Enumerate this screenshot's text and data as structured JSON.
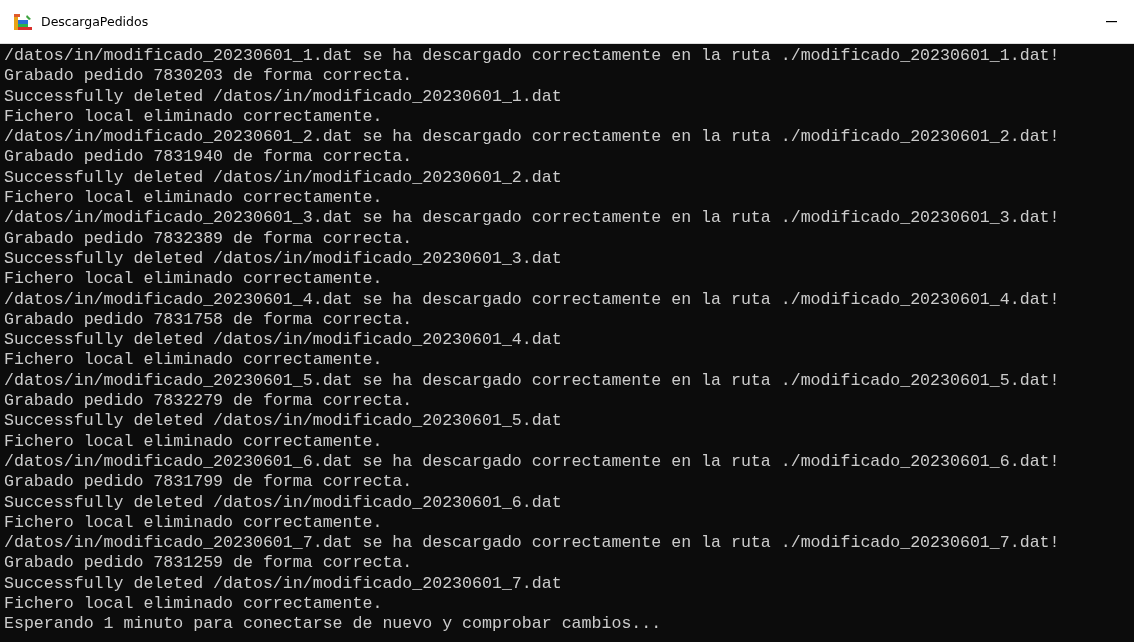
{
  "window": {
    "title": "DescargaPedidos"
  },
  "console": {
    "lines": [
      "/datos/in/modificado_20230601_1.dat se ha descargado correctamente en la ruta ./modificado_20230601_1.dat!",
      "Grabado pedido 7830203 de forma correcta.",
      "Successfully deleted /datos/in/modificado_20230601_1.dat",
      "Fichero local eliminado correctamente.",
      "/datos/in/modificado_20230601_2.dat se ha descargado correctamente en la ruta ./modificado_20230601_2.dat!",
      "Grabado pedido 7831940 de forma correcta.",
      "Successfully deleted /datos/in/modificado_20230601_2.dat",
      "Fichero local eliminado correctamente.",
      "/datos/in/modificado_20230601_3.dat se ha descargado correctamente en la ruta ./modificado_20230601_3.dat!",
      "Grabado pedido 7832389 de forma correcta.",
      "Successfully deleted /datos/in/modificado_20230601_3.dat",
      "Fichero local eliminado correctamente.",
      "/datos/in/modificado_20230601_4.dat se ha descargado correctamente en la ruta ./modificado_20230601_4.dat!",
      "Grabado pedido 7831758 de forma correcta.",
      "Successfully deleted /datos/in/modificado_20230601_4.dat",
      "Fichero local eliminado correctamente.",
      "/datos/in/modificado_20230601_5.dat se ha descargado correctamente en la ruta ./modificado_20230601_5.dat!",
      "Grabado pedido 7832279 de forma correcta.",
      "Successfully deleted /datos/in/modificado_20230601_5.dat",
      "Fichero local eliminado correctamente.",
      "/datos/in/modificado_20230601_6.dat se ha descargado correctamente en la ruta ./modificado_20230601_6.dat!",
      "Grabado pedido 7831799 de forma correcta.",
      "Successfully deleted /datos/in/modificado_20230601_6.dat",
      "Fichero local eliminado correctamente.",
      "/datos/in/modificado_20230601_7.dat se ha descargado correctamente en la ruta ./modificado_20230601_7.dat!",
      "Grabado pedido 7831259 de forma correcta.",
      "Successfully deleted /datos/in/modificado_20230601_7.dat",
      "Fichero local eliminado correctamente.",
      "Esperando 1 minuto para conectarse de nuevo y comprobar cambios..."
    ]
  }
}
